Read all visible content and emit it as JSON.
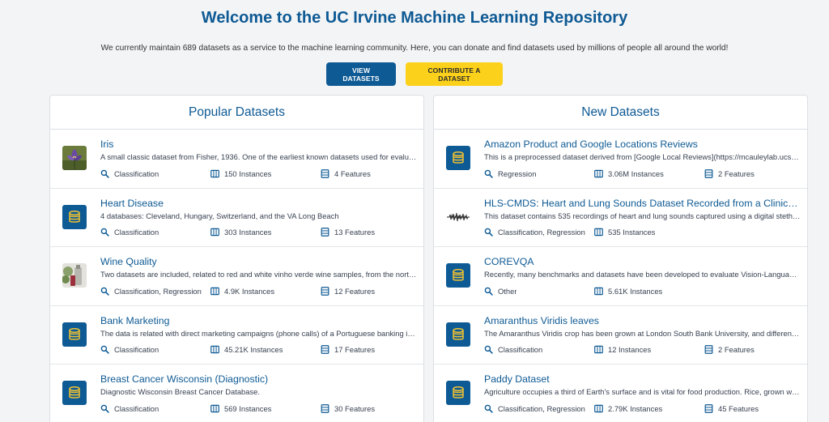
{
  "hero": {
    "title": "Welcome to the UC Irvine Machine Learning Repository",
    "subtitle": "We currently maintain 689 datasets as a service to the machine learning community. Here, you can donate and find datasets used by millions of people all around the world!",
    "view_label": "VIEW DATASETS",
    "contribute_label": "CONTRIBUTE A DATASET"
  },
  "colors": {
    "brand_blue": "#0e5a94",
    "accent_yellow": "#fcd11b"
  },
  "popular": {
    "title": "Popular Datasets",
    "items": [
      {
        "title": "Iris",
        "desc": "A small classic dataset from Fisher, 1936. One of the earliest known datasets used for evaluating classification methods.",
        "task": "Classification",
        "instances": "150 Instances",
        "features": "4 Features",
        "thumb": "iris-flower-image"
      },
      {
        "title": "Heart Disease",
        "desc": "4 databases: Cleveland, Hungary, Switzerland, and the VA Long Beach",
        "task": "Classification",
        "instances": "303 Instances",
        "features": "13 Features",
        "thumb": "database-icon"
      },
      {
        "title": "Wine Quality",
        "desc": "Two datasets are included, related to red and white vinho verde wine samples, from the north of Portugal.",
        "task": "Classification, Regression",
        "instances": "4.9K Instances",
        "features": "12 Features",
        "thumb": "wine-image"
      },
      {
        "title": "Bank Marketing",
        "desc": "The data is related with direct marketing campaigns (phone calls) of a Portuguese banking institution.",
        "task": "Classification",
        "instances": "45.21K Instances",
        "features": "17 Features",
        "thumb": "database-icon"
      },
      {
        "title": "Breast Cancer Wisconsin (Diagnostic)",
        "desc": "Diagnostic Wisconsin Breast Cancer Database.",
        "task": "Classification",
        "instances": "569 Instances",
        "features": "30 Features",
        "thumb": "database-icon"
      }
    ]
  },
  "new": {
    "title": "New Datasets",
    "items": [
      {
        "title": "Amazon Product and Google Locations Reviews",
        "desc": "This is a preprocessed dataset derived from [Google Local Reviews](https://mcauleylab.ucsd.edu/public_datasets/gdrive/googlelocal/)",
        "task": "Regression",
        "instances": "3.06M Instances",
        "features": "2 Features",
        "thumb": "database-icon"
      },
      {
        "title": "HLS-CMDS: Heart and Lung Sounds Dataset Recorded from a Clinical Manikin",
        "desc": "This dataset contains 535 recordings of heart and lung sounds captured using a digital stethoscope.",
        "task": "Classification, Regression",
        "instances": "535 Instances",
        "features": "",
        "thumb": "waveform-image"
      },
      {
        "title": "COREVQA",
        "desc": "Recently, many benchmarks and datasets have been developed to evaluate Vision-Language Models.",
        "task": "Other",
        "instances": "5.61K Instances",
        "features": "",
        "thumb": "database-icon"
      },
      {
        "title": "Amaranthus Viridis leaves",
        "desc": "The Amaranthus Viridis crop has been grown at London South Bank University, and different stages were recorded.",
        "task": "Classification",
        "instances": "12 Instances",
        "features": "2 Features",
        "thumb": "database-icon"
      },
      {
        "title": "Paddy Dataset",
        "desc": "Agriculture occupies a third of Earth's surface and is vital for food production. Rice, grown worldwide.",
        "task": "Classification, Regression",
        "instances": "2.79K Instances",
        "features": "45 Features",
        "thumb": "database-icon"
      }
    ]
  }
}
